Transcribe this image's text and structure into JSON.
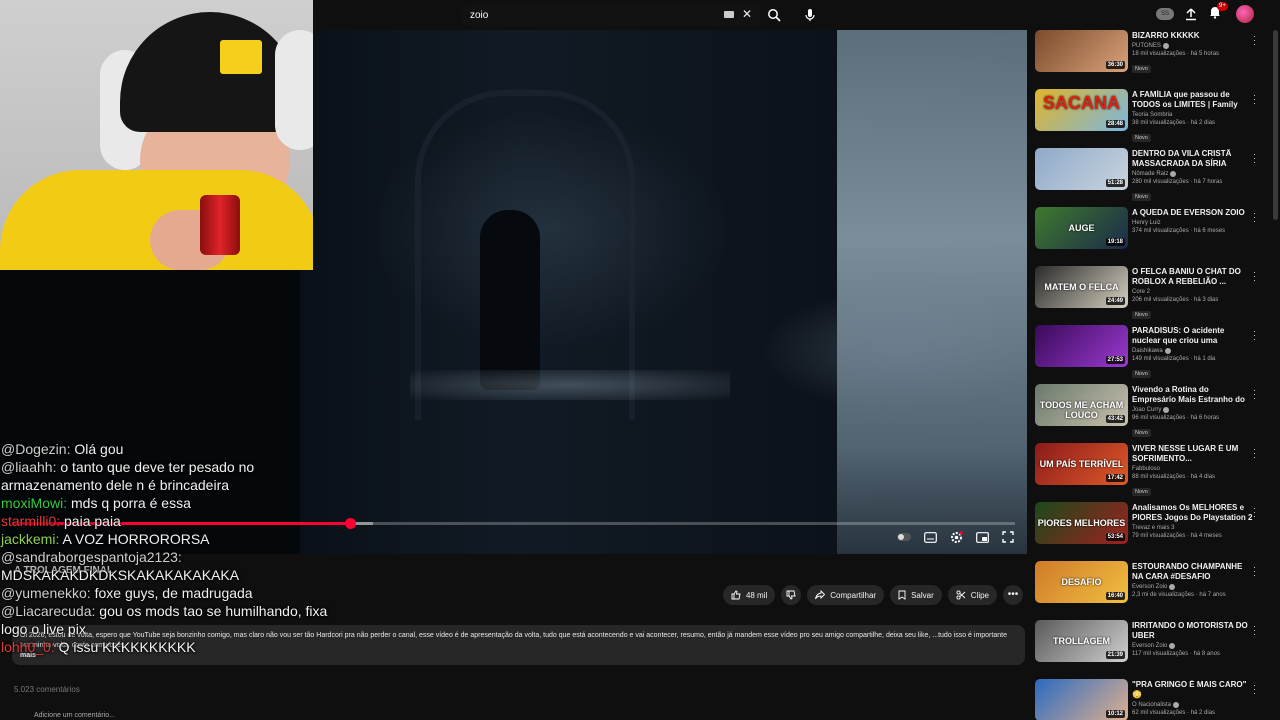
{
  "search": {
    "query": "zoio"
  },
  "notifications": {
    "count": "9+"
  },
  "top_right": {
    "ss_label": "SS"
  },
  "video": {
    "progress": 0.337,
    "buffered": 0.36
  },
  "chat": [
    {
      "user": "@Dogezin:",
      "text": "Olá gou",
      "color": "#cfcfcf"
    },
    {
      "user": "@liaahh:",
      "text": "o tanto que deve ter pesado no armazenamento dele n é brincadeira",
      "color": "#cfcfcf"
    },
    {
      "user": "moxiMowi:",
      "text": "mds q porra é essa",
      "color": "#2ecc40"
    },
    {
      "user": "starmilli0:",
      "text": "paia paia",
      "color": "#e53935"
    },
    {
      "user": "jackkemi:",
      "text": "A VOZ HORRORORSA",
      "color": "#8fd14f"
    },
    {
      "user": "@sandraborgespantoja2123:",
      "text": "MDSKAKAKDKDKSKAKAKAKAKAKA",
      "color": "#cfcfcf"
    },
    {
      "user": "@yumenekko:",
      "text": "foxe guys, de madrugada",
      "color": "#cfcfcf"
    },
    {
      "user": "@Liacarecuda:",
      "text": "gou os mods tao se humilhando, fixa logo o live pix",
      "color": "#cfcfcf"
    },
    {
      "user": "lohh0_0:",
      "text": "Q issu KKKKKKKKKK",
      "color": "#e53935"
    }
  ],
  "below": {
    "title": "A TROLAGEM FINAL",
    "likes": "48 mil",
    "share": "Compartilhar",
    "save": "Salvar",
    "clip": "Clipe",
    "description": "Oi 2026, estou de volta, espero que YouTube seja bonzinho comigo, mas claro não vou ser tão Hardcori pra não perder o canal, esse vídeo é de apresentação da volta, tudo que está acontecendo e vai acontecer, resumo, então já mandem esse vídeo pro seu amigo compartilhe, deixa seu like, ...tudo isso é importante pra minha volta, conto com vocês",
    "more": "mais",
    "comments": "5.023 comentários",
    "add_comment": "Adicione um comentário..."
  },
  "recommendations": [
    {
      "title": "BIZARRO KKKKK",
      "channel": "PUTONES",
      "verified": true,
      "meta": "18 mil visualizações · há 5 horas",
      "badge": "Novo",
      "duration": "36:30",
      "thumb_text": "",
      "colors": [
        "#7a4a2a",
        "#d9a27a"
      ]
    },
    {
      "title": "A FAMÍLIA que passou de TODOS os LIMITES | Family Guy",
      "channel": "Teoria Sombria",
      "verified": false,
      "meta": "38 mil visualizações · há 2 dias",
      "badge": "Novo",
      "duration": "28:48",
      "thumb_text": "SACANA",
      "colors": [
        "#e0b52a",
        "#7ab6e0"
      ]
    },
    {
      "title": "DENTRO DA VILA CRISTÃ MASSACRADA DA SÍRIA",
      "channel": "Nômade Raiz",
      "verified": true,
      "meta": "280 mil visualizações · há 7 horas",
      "badge": "Novo",
      "duration": "51:28",
      "thumb_text": "",
      "colors": [
        "#8fa9c9",
        "#c9d4df"
      ]
    },
    {
      "title": "A QUEDA DE EVERSON ZOIO",
      "channel": "Henry Luiz",
      "verified": false,
      "meta": "374 mil visualizações · há 6 meses",
      "badge": "",
      "duration": "19:18",
      "thumb_text": "AUGE",
      "colors": [
        "#3e7a2e",
        "#1b2a4a"
      ]
    },
    {
      "title": "O FELCA BANIU O CHAT DO ROBLOX A REBELIÃO ...",
      "channel": "Core 2",
      "verified": false,
      "meta": "206 mil visualizações · há 3 dias",
      "badge": "Novo",
      "duration": "24:49",
      "thumb_text": "MATEM O FELCA",
      "colors": [
        "#2a2a2a",
        "#d6d0c0"
      ]
    },
    {
      "title": "PARADISUS: O acidente nuclear que criou uma ENTIDADE ...",
      "channel": "Daishikawa",
      "verified": true,
      "meta": "149 mil visualizações · há 1 dia",
      "badge": "Novo",
      "duration": "27:53",
      "thumb_text": "",
      "colors": [
        "#3a0a5a",
        "#9a3ad0"
      ]
    },
    {
      "title": "Vivendo a Rotina do Empresário Mais Estranho do Brasil - ...",
      "channel": "Joao Curry",
      "verified": true,
      "meta": "96 mil visualizações · há 6 horas",
      "badge": "Novo",
      "duration": "43:42",
      "thumb_text": "TODOS ME ACHAM LOUCO",
      "colors": [
        "#6a7a6a",
        "#c9c0b0"
      ]
    },
    {
      "title": "VIVER NESSE LUGAR É UM SOFRIMENTO...",
      "channel": "Fabbuloso",
      "verified": false,
      "meta": "88 mil visualizações · há 4 dias",
      "badge": "Novo",
      "duration": "17:42",
      "thumb_text": "UM PAÍS TERRÍVEL",
      "colors": [
        "#8a1a1a",
        "#e05a2a"
      ]
    },
    {
      "title": "Analisamos Os MELHORES e PIORES Jogos Do Playstation 2",
      "channel": "Trevaz e mais 3",
      "verified": false,
      "meta": "79 mil visualizações · há 4 meses",
      "badge": "",
      "duration": "53:54",
      "thumb_text": "PIORES MELHORES",
      "colors": [
        "#1a4a1a",
        "#a02020"
      ]
    },
    {
      "title": "ESTOURANDO CHAMPANHE NA CARA #DESAFIO",
      "channel": "Everson Zoio",
      "verified": true,
      "meta": "2,3 mi de visualizações · há 7 anos",
      "badge": "",
      "duration": "16:40",
      "thumb_text": "DESAFIO",
      "colors": [
        "#d07a2a",
        "#f0c040"
      ]
    },
    {
      "title": "IRRITANDO O MOTORISTA DO UBER",
      "channel": "Everson Zoio",
      "verified": true,
      "meta": "117 mil visualizações · há 8 anos",
      "badge": "",
      "duration": "21:39",
      "thumb_text": "TROLLAGEM",
      "colors": [
        "#5a5a5a",
        "#cfcfcf"
      ]
    },
    {
      "title": "\"PRA GRINGO É MAIS CARO\" 😳",
      "channel": "O Nacionalista",
      "verified": true,
      "meta": "62 mil visualizações · há 2 dias",
      "badge": "Novo",
      "duration": "10:12",
      "thumb_text": "",
      "colors": [
        "#2a6ac0",
        "#e0b090"
      ]
    }
  ]
}
